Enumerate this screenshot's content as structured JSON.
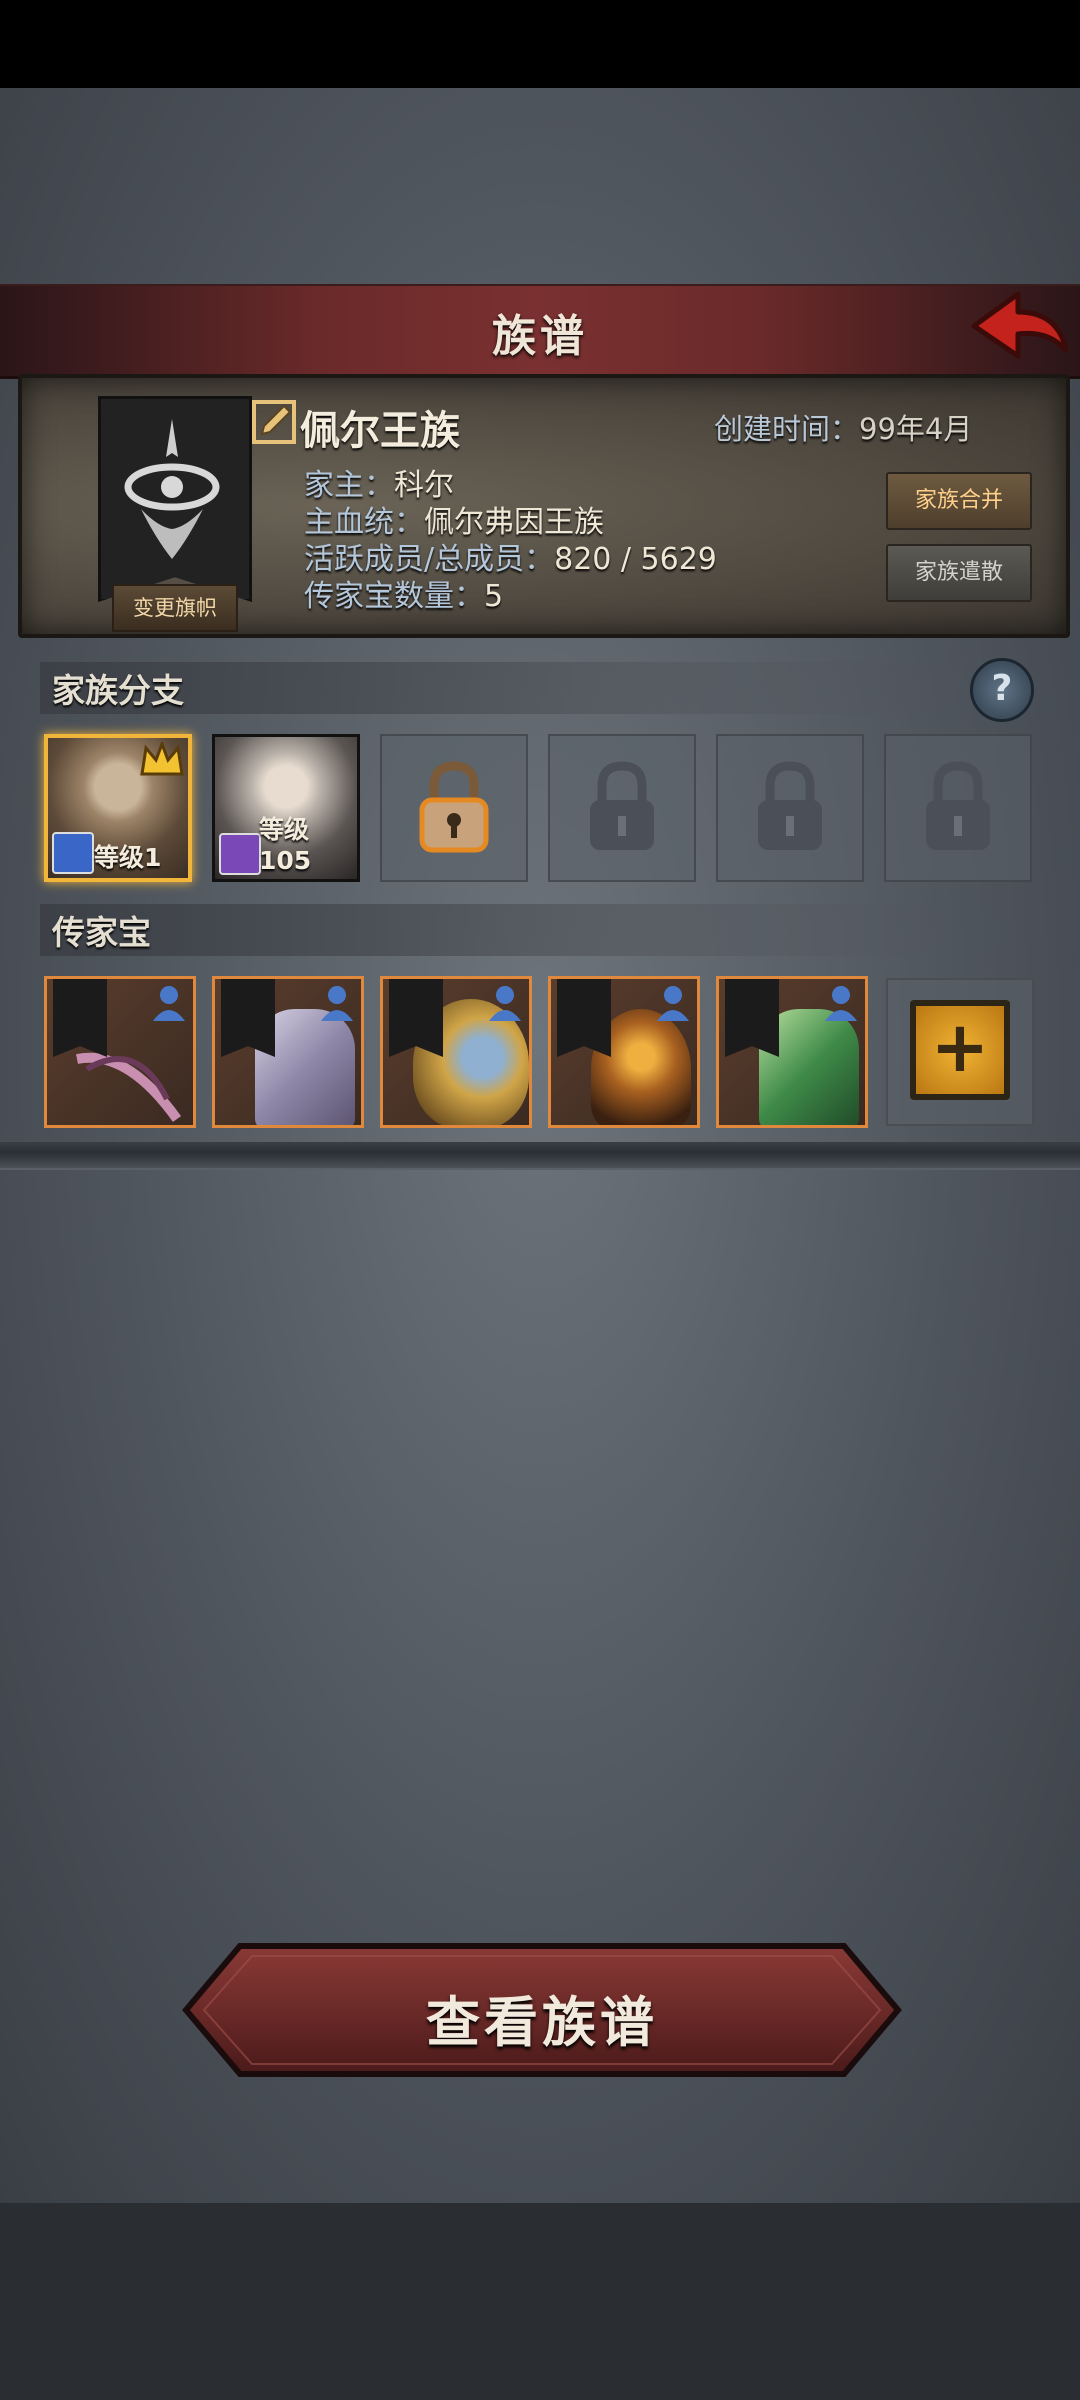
{
  "header": {
    "title": "族谱"
  },
  "clan": {
    "name": "佩尔王族",
    "created_label": "创建时间：",
    "created_value": "99年4月",
    "leader_label": "家主：",
    "leader_value": "科尔",
    "bloodline_label": "主血统：",
    "bloodline_value": "佩尔弗因王族",
    "members_label": "活跃成员/总成员：",
    "members_value": "820 / 5629",
    "heirloom_count_label": "传家宝数量：",
    "heirloom_count_value": "5",
    "change_banner_label": "变更旗帜",
    "merge_label": "家族合并",
    "disband_label": "家族遣散"
  },
  "branches": {
    "title": "家族分支",
    "members": [
      {
        "level_text": "等级1",
        "class_icon": "sword-icon",
        "is_head": true
      },
      {
        "level_text": "等级105",
        "class_icon": "staff-icon",
        "is_head": false
      }
    ],
    "slots": [
      "unlockable",
      "locked",
      "locked",
      "locked"
    ]
  },
  "heirlooms": {
    "title": "传家宝",
    "items": [
      "bow",
      "armor",
      "shield",
      "staff",
      "armor"
    ]
  },
  "actions": {
    "view_genealogy_label": "查看族谱"
  },
  "colors": {
    "accent_red": "#7a3030",
    "heirloom_border": "#e0883c",
    "add_button": "#f2b334"
  }
}
